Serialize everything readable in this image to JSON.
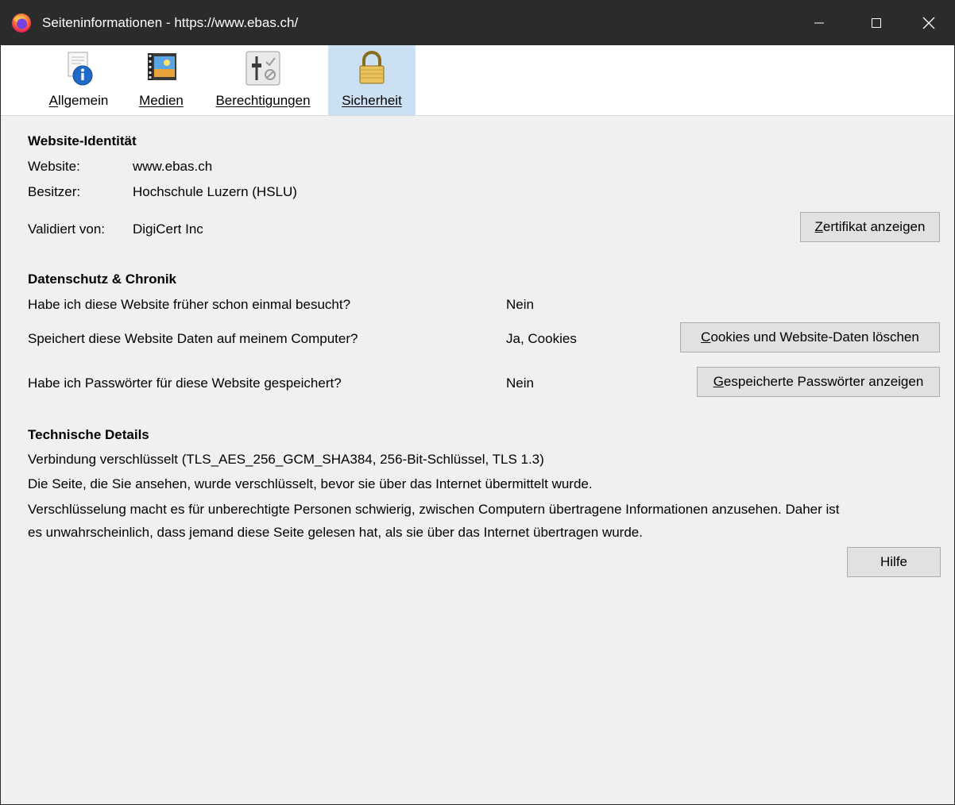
{
  "window": {
    "title": "Seiteninformationen - https://www.ebas.ch/",
    "controls": {
      "minimize_icon": "minimize-icon",
      "maximize_icon": "maximize-icon",
      "close_icon": "close-icon"
    }
  },
  "tabs": [
    {
      "label": "Allgemein",
      "accesskey": "A",
      "rest": "llgemein",
      "icon": "info-icon",
      "selected": false
    },
    {
      "label": "Medien",
      "accesskey": "M",
      "rest": "edien",
      "icon": "media-icon",
      "selected": false
    },
    {
      "label": "Berechtigungen",
      "accesskey": "B",
      "rest": "erechtigungen",
      "icon": "permissions-icon",
      "selected": false
    },
    {
      "label": "Sicherheit",
      "accesskey": "S",
      "rest": "icherheit",
      "icon": "lock-icon",
      "selected": true
    }
  ],
  "identity": {
    "heading": "Website-Identität",
    "website_label": "Website:",
    "website_value": "www.ebas.ch",
    "owner_label": "Besitzer:",
    "owner_value": "Hochschule Luzern (HSLU)",
    "verifier_label": "Validiert von:",
    "verifier_value": "DigiCert Inc",
    "cert_button_accesskey": "Z",
    "cert_button_rest": "ertifikat anzeigen"
  },
  "privacy": {
    "heading": "Datenschutz & Chronik",
    "visited_question": "Habe ich diese Website früher schon einmal besucht?",
    "visited_answer": "Nein",
    "cookies_question": "Speichert diese Website Daten auf meinem Computer?",
    "cookies_answer": "Ja, Cookies",
    "cookies_button_accesskey": "C",
    "cookies_button_rest": "ookies und Website-Daten löschen",
    "passwords_question": "Habe ich Passwörter für diese Website gespeichert?",
    "passwords_answer": "Nein",
    "passwords_button_accesskey": "G",
    "passwords_button_rest": "espeicherte Passwörter anzeigen"
  },
  "technical": {
    "heading": "Technische Details",
    "line1": "Verbindung verschlüsselt (TLS_AES_256_GCM_SHA384, 256-Bit-Schlüssel, TLS 1.3)",
    "line2": "Die Seite, die Sie ansehen, wurde verschlüsselt, bevor sie über das Internet übermittelt wurde.",
    "line3": "Verschlüsselung macht es für unberechtigte Personen schwierig, zwischen Computern übertragene Informationen anzusehen. Daher ist",
    "line4": "es unwahrscheinlich, dass jemand diese Seite gelesen hat, als sie über das Internet übertragen wurde."
  },
  "help_button": "Hilfe",
  "colors": {
    "titlebar": "#2b2b2b",
    "selected_tab": "#cce0f3",
    "button_bg": "#e1e1e1",
    "window_bg": "#f0f0f0"
  }
}
